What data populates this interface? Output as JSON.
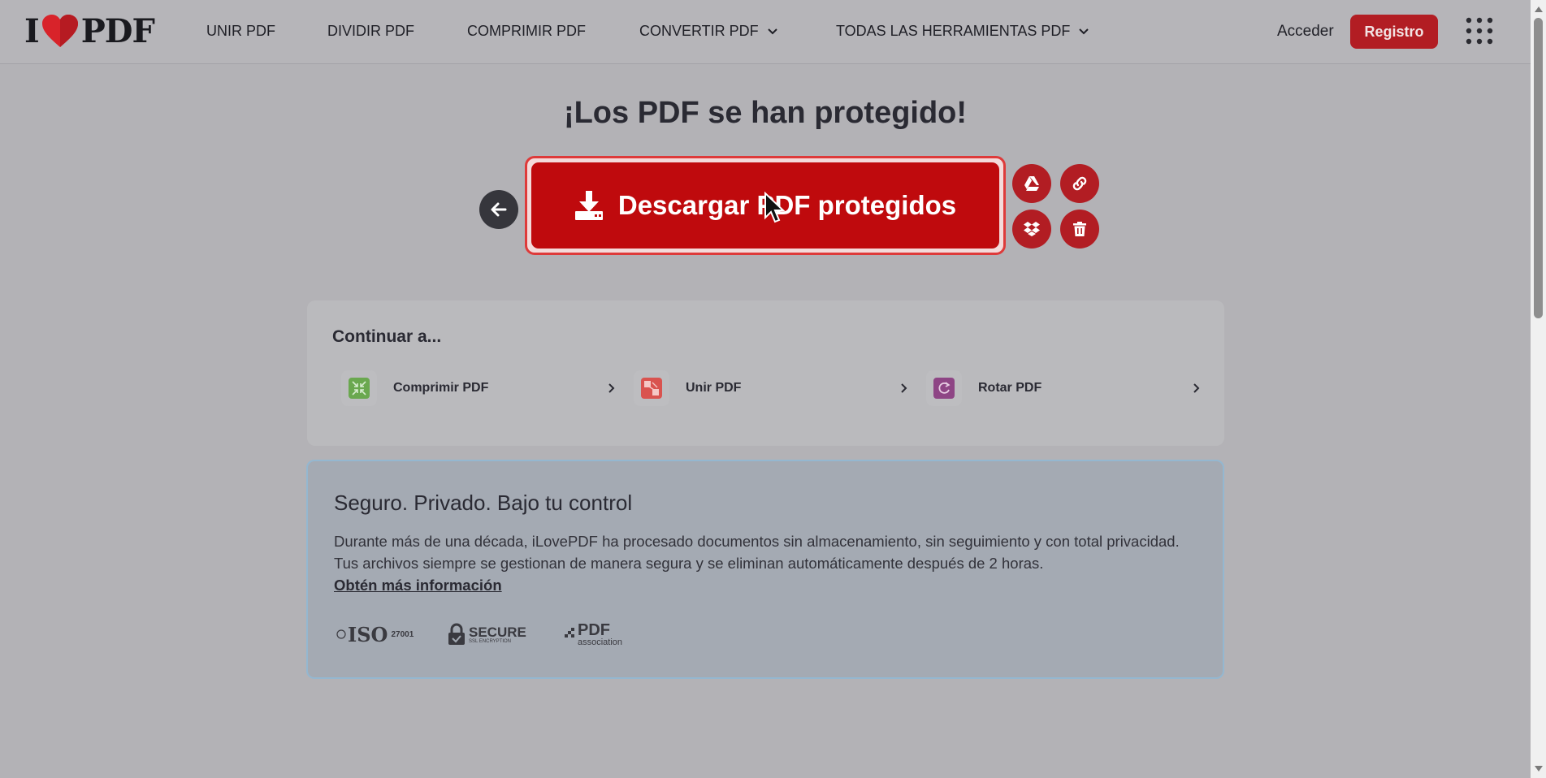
{
  "header": {
    "logo_left": "I",
    "logo_right": "PDF",
    "nav": [
      {
        "label": "UNIR PDF"
      },
      {
        "label": "DIVIDIR PDF"
      },
      {
        "label": "COMPRIMIR PDF"
      },
      {
        "label": "CONVERTIR PDF"
      },
      {
        "label": "TODAS LAS HERRAMIENTAS PDF"
      }
    ],
    "login": "Acceder",
    "register": "Registro"
  },
  "main": {
    "heading": "¡Los PDF se han protegido!",
    "download_label": "Descargar PDF protegidos",
    "actions": [
      "google-drive-icon",
      "link-icon",
      "dropbox-icon",
      "trash-icon"
    ]
  },
  "continue": {
    "title": "Continuar a...",
    "tools": [
      {
        "label": "Comprimir PDF",
        "color": "#6aa84f"
      },
      {
        "label": "Unir PDF",
        "color": "#d9534f"
      },
      {
        "label": "Rotar PDF",
        "color": "#8e4585"
      }
    ]
  },
  "secure": {
    "title": "Seguro. Privado. Bajo tu control",
    "text": "Durante más de una década, iLovePDF ha procesado documentos sin almacenamiento, sin seguimiento y con total privacidad. Tus archivos siempre se gestionan de manera segura y se eliminan automáticamente después de 2 horas.",
    "link": "Obtén más información",
    "badges": {
      "iso": "ISO",
      "iso_num": "27001",
      "secure": "SECURE",
      "secure_sub": "SSL ENCRYPTION",
      "pdfa": "PDF",
      "pdfa_sub": "association"
    }
  },
  "colors": {
    "brand_red": "#bf0a0d",
    "overlay_bg": "#b3b2b6"
  }
}
